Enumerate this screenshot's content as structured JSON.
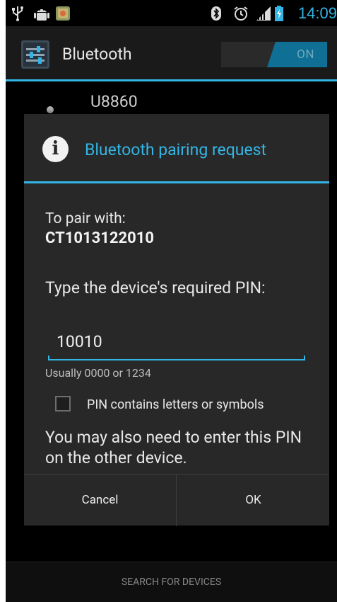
{
  "status_bar": {
    "time": "14:09",
    "icons": [
      "usb-icon",
      "android-debug-icon",
      "app-notification-icon",
      "bluetooth-icon",
      "alarm-icon",
      "signal-icon",
      "battery-icon"
    ]
  },
  "action_bar": {
    "title": "Bluetooth",
    "toggle_label": "ON",
    "accent_color": "#33b5e5"
  },
  "device_list": {
    "first_device": "U8860"
  },
  "dialog": {
    "title": "Bluetooth pairing request",
    "pair_with_label": "To pair with:",
    "device_name": "CT1013122010",
    "pin_prompt": "Type the device's required PIN:",
    "pin_value": "10010",
    "pin_hint": "Usually 0000 or 1234",
    "checkbox_label": "PIN contains letters or symbols",
    "checkbox_checked": false,
    "note": "You may also need to enter this PIN on the other device.",
    "cancel_label": "Cancel",
    "ok_label": "OK"
  },
  "bottom": {
    "search_label": "SEARCH FOR DEVICES"
  }
}
